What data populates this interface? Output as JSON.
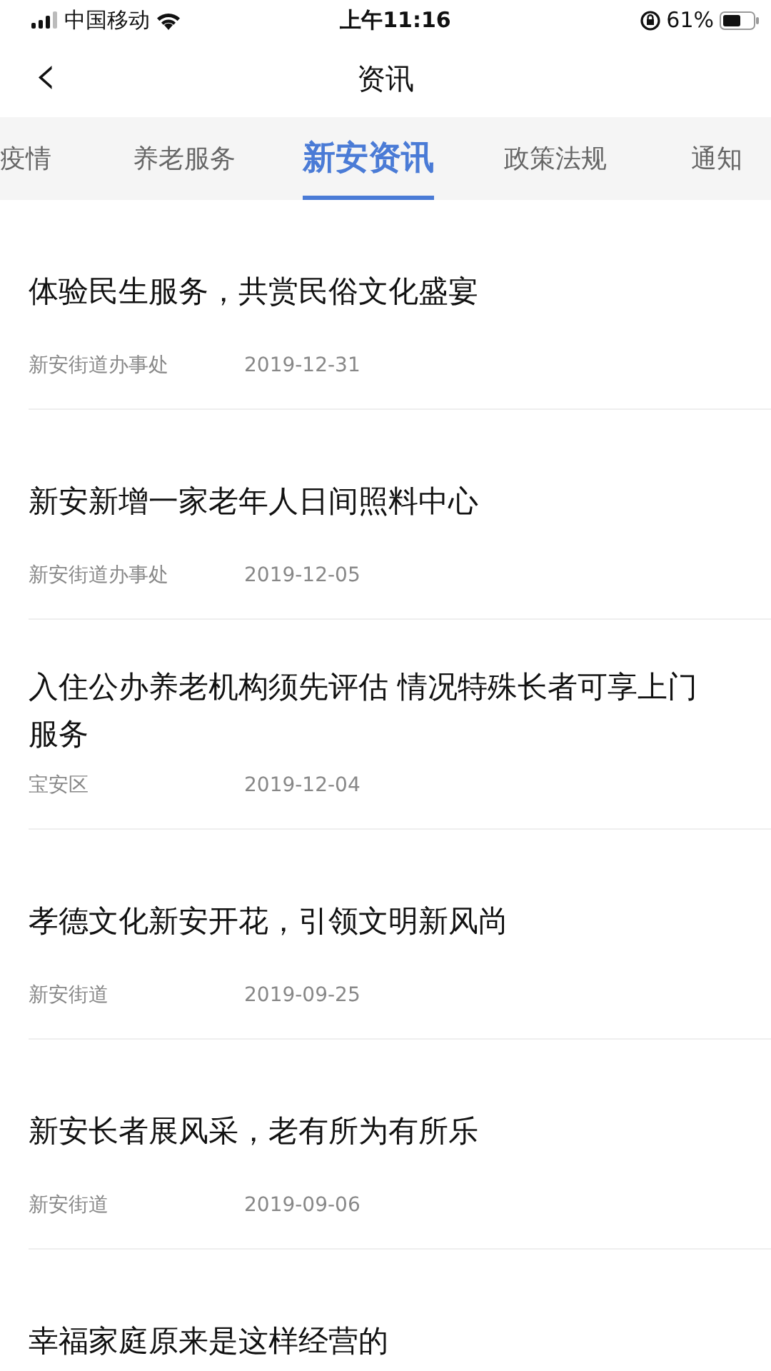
{
  "status_bar": {
    "carrier": "中国移动",
    "time": "上午11:16",
    "battery_percent": "61%"
  },
  "header": {
    "back": "‹",
    "title": "资讯"
  },
  "tabs": [
    {
      "label": "疫情",
      "selected": false
    },
    {
      "label": "养老服务",
      "selected": false
    },
    {
      "label": "新安资讯",
      "selected": true
    },
    {
      "label": "政策法规",
      "selected": false
    },
    {
      "label": "通知",
      "selected": false
    }
  ],
  "articles": [
    {
      "title": "体验民生服务，共赏民俗文化盛宴",
      "source": "新安街道办事处",
      "date": "2019-12-31"
    },
    {
      "title": "新安新增一家老年人日间照料中心",
      "source": "新安街道办事处",
      "date": "2019-12-05"
    },
    {
      "title": "入住公办养老机构须先评估 情况特殊长者可享上门服务",
      "source": "宝安区",
      "date": "2019-12-04"
    },
    {
      "title": "孝德文化新安开花，引领文明新风尚",
      "source": "新安街道",
      "date": "2019-09-25"
    },
    {
      "title": "新安长者展风采，老有所为有所乐",
      "source": "新安街道",
      "date": "2019-09-06"
    },
    {
      "title": "幸福家庭原来是这样经营的"
    }
  ]
}
